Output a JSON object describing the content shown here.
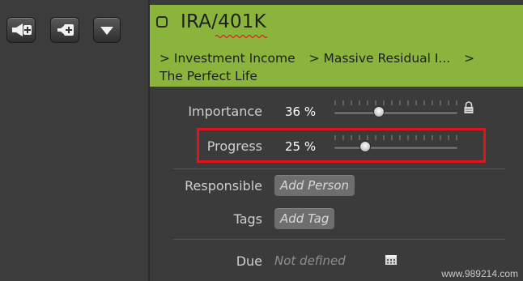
{
  "toolbar": {
    "buttons": [
      {
        "icon": "add-megaphone-icon"
      },
      {
        "icon": "add-task-icon"
      },
      {
        "icon": "chevron-down-icon"
      }
    ]
  },
  "header": {
    "title": "IRA/401K",
    "breadcrumb": [
      "> Investment Income",
      "> Massive Residual I...",
      ">",
      "The Perfect Life"
    ],
    "background_color": "#8ab43b"
  },
  "fields": {
    "importance": {
      "label": "Importance",
      "value": "36 %",
      "level": 0.36,
      "lock_icon": "lock-icon"
    },
    "progress": {
      "label": "Progress",
      "value": "25 %",
      "level": 0.25
    },
    "responsible": {
      "label": "Responsible",
      "button": "Add Person"
    },
    "tags": {
      "label": "Tags",
      "button": "Add Tag"
    },
    "due": {
      "label": "Due",
      "value": "Not defined",
      "icon": "calendar-icon"
    }
  },
  "highlight_color": "#e0151b",
  "watermark": "www.989214.com"
}
